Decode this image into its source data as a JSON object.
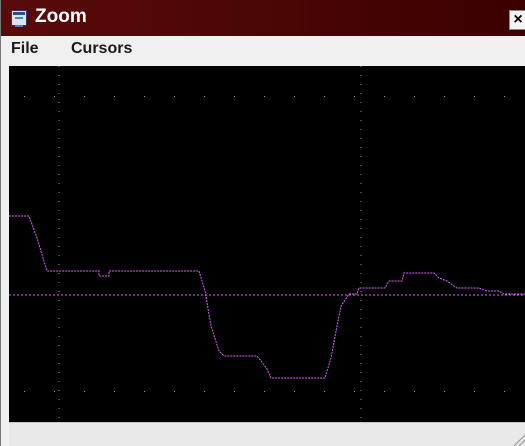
{
  "window": {
    "title": "Zoom",
    "close_label": "×"
  },
  "menu": {
    "items": [
      "File",
      "Cursors"
    ]
  },
  "icons": {
    "app": "zoom-app-icon",
    "close": "close-icon",
    "grip": "size-grip-icon"
  },
  "colors": {
    "titlebar": "#4a0505",
    "plot_background": "#000000",
    "trace": "#e060ff",
    "grid": "#9a9a9a"
  }
}
